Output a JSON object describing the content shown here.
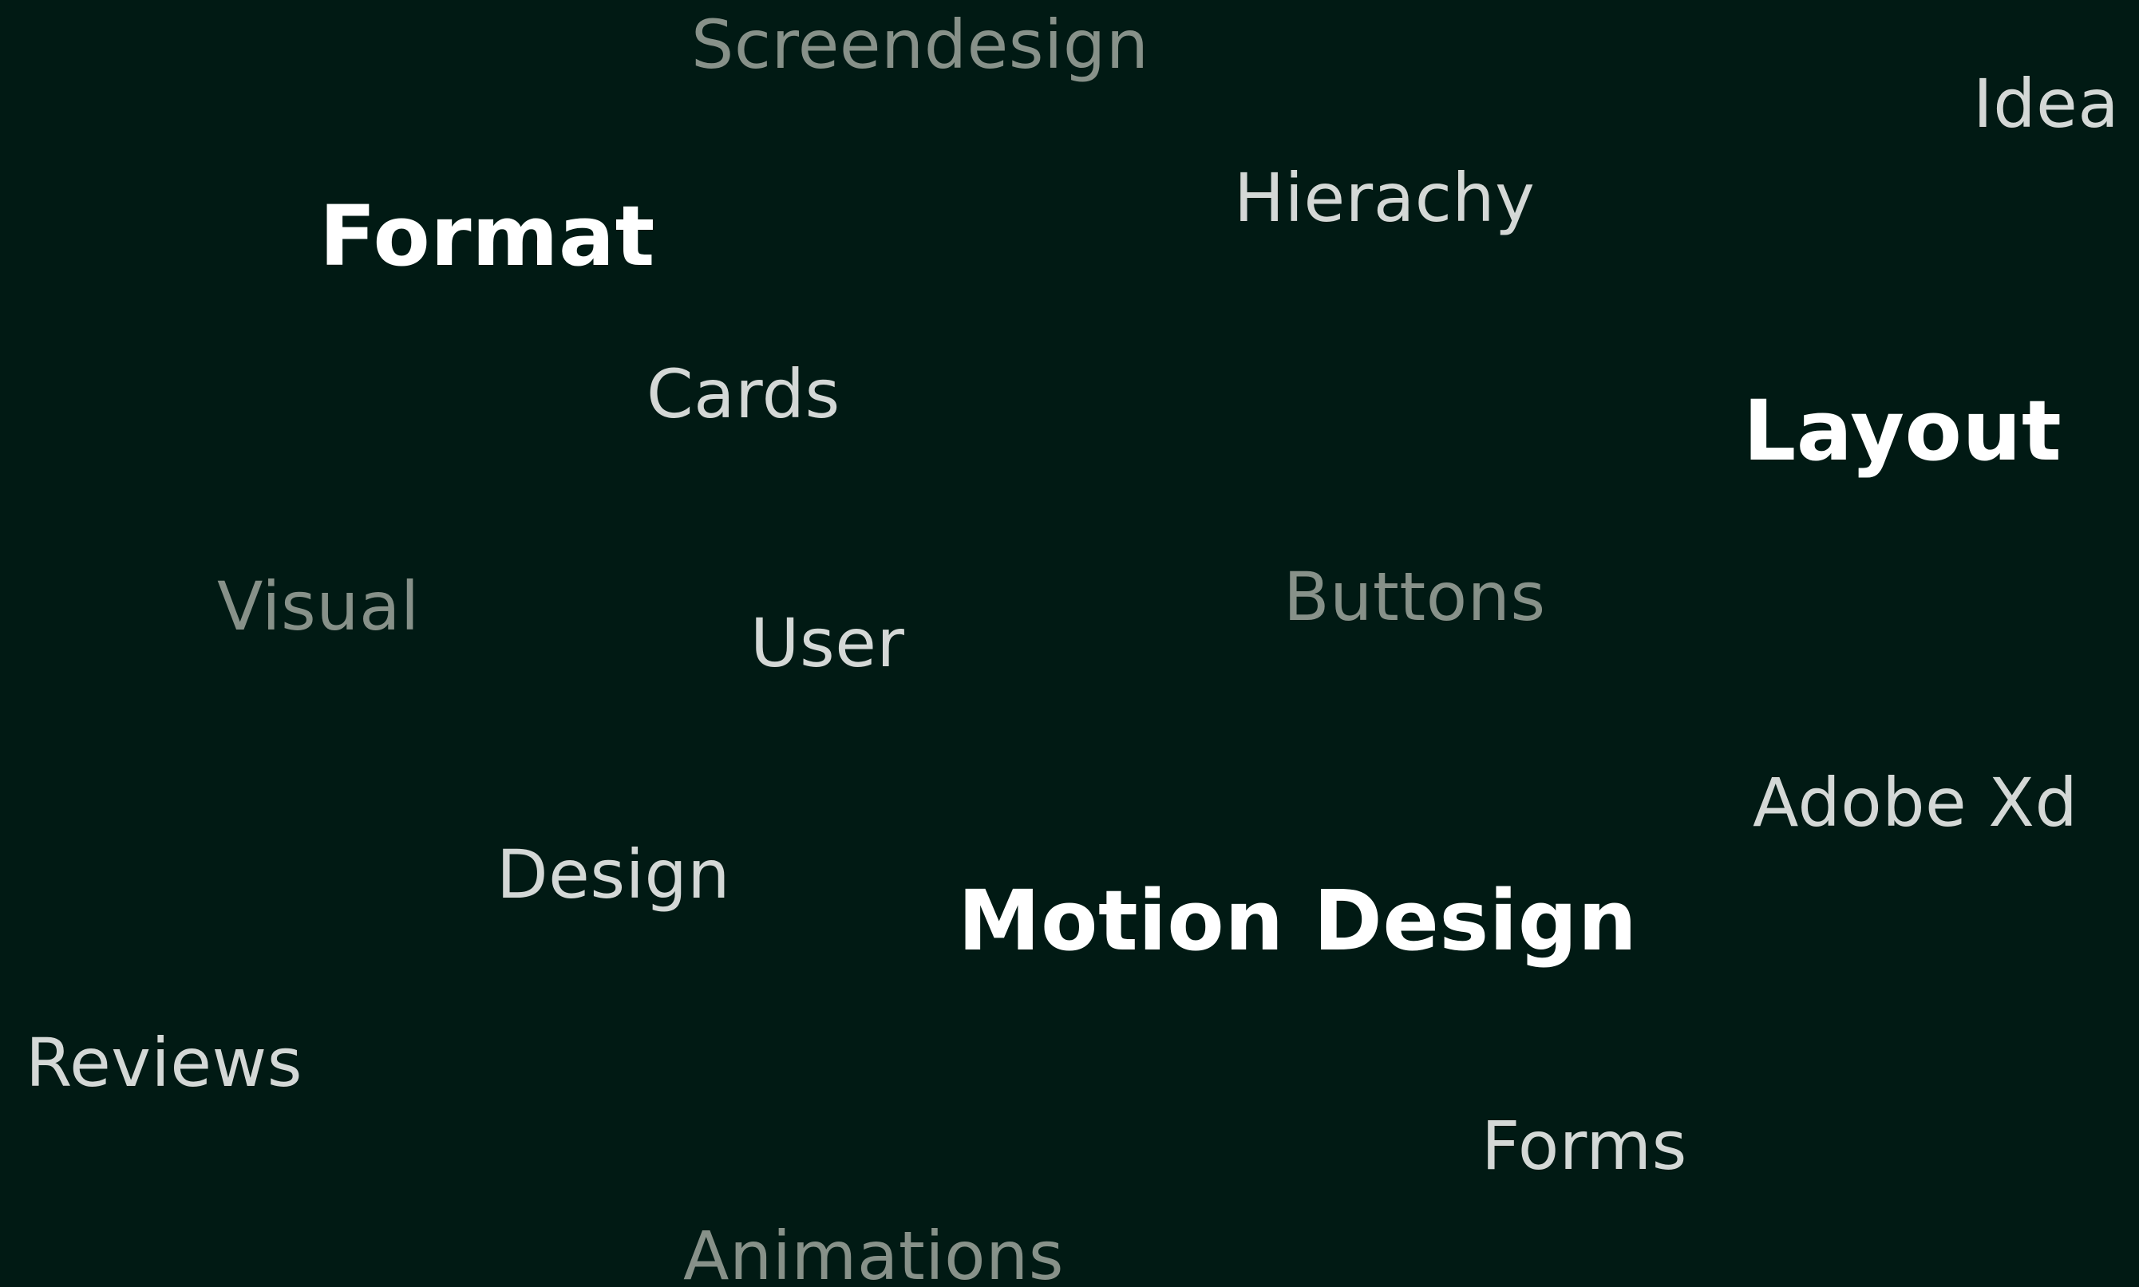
{
  "cloud": {
    "words": {
      "screendesign": "Screendesign",
      "idea": "Idea",
      "hierachy": "Hierachy",
      "format": "Format",
      "cards": "Cards",
      "layout": "Layout",
      "visual": "Visual",
      "buttons": "Buttons",
      "user": "User",
      "adobe_xd": "Adobe Xd",
      "design": "Design",
      "motion_design": "Motion Design",
      "reviews": "Reviews",
      "forms": "Forms",
      "animations": "Animations"
    }
  },
  "colors": {
    "background": "#011a14",
    "strong_text": "#ffffff",
    "light_text": "#d4d8d6",
    "dim_text": "#879189"
  }
}
